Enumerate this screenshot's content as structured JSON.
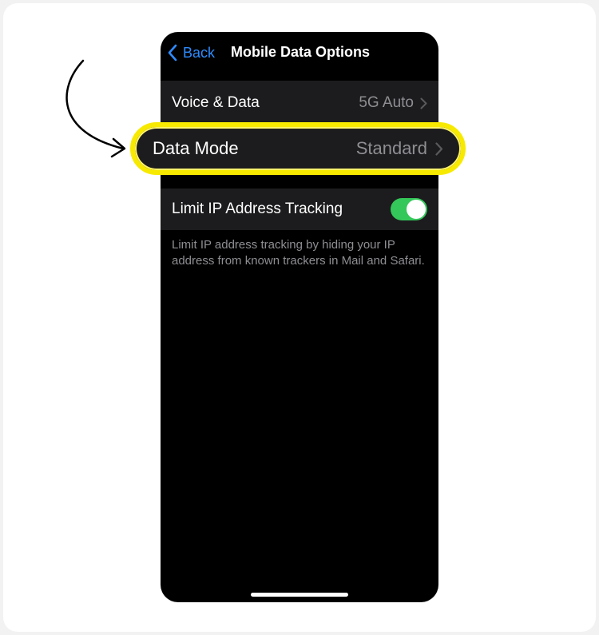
{
  "navbar": {
    "back_label": "Back",
    "title": "Mobile Data Options"
  },
  "rows": {
    "voice_data": {
      "label": "Voice & Data",
      "value": "5G Auto"
    },
    "data_mode": {
      "label": "Data Mode",
      "value": "Standard"
    },
    "limit_ip": {
      "label": "Limit IP Address Tracking",
      "toggle_on": true
    }
  },
  "footnote": "Limit IP address tracking by hiding your IP address from known trackers in Mail and Safari.",
  "colors": {
    "accent": "#2f8cff",
    "toggle_on": "#34c759",
    "highlight": "#f7ea00",
    "cell_bg": "#1c1c1e",
    "secondary_text": "#8e8e93"
  },
  "icons": [
    "chevron-left-icon",
    "chevron-right-icon",
    "curved-arrow-icon"
  ]
}
